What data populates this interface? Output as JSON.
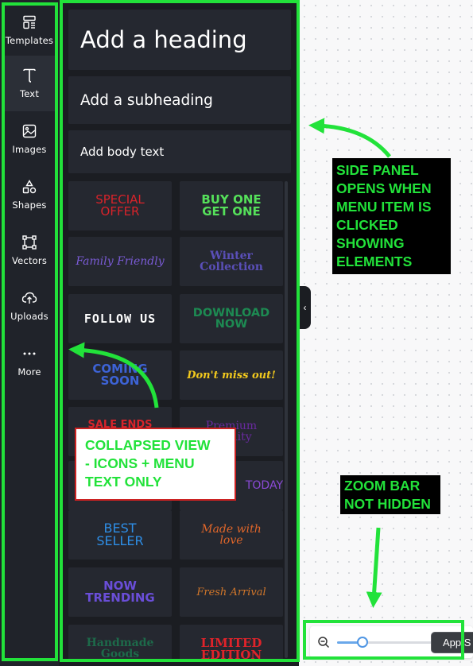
{
  "rail": {
    "items": [
      {
        "label": "Templates",
        "icon": "templates-icon"
      },
      {
        "label": "Text",
        "icon": "text-icon"
      },
      {
        "label": "Images",
        "icon": "image-icon"
      },
      {
        "label": "Shapes",
        "icon": "shapes-icon"
      },
      {
        "label": "Vectors",
        "icon": "vectors-icon"
      },
      {
        "label": "Uploads",
        "icon": "upload-icon"
      },
      {
        "label": "More",
        "icon": "more-icon"
      }
    ],
    "active": "Text"
  },
  "panel": {
    "heading": "Add a heading",
    "subheading": "Add a subheading",
    "body": "Add body text",
    "tiles": [
      {
        "l1": "SPECIAL",
        "l2": "OFFER",
        "color": "#d8232a"
      },
      {
        "l1": "BUY ONE",
        "l2": "GET ONE",
        "color": "#55e05a"
      },
      {
        "l1": "Family Friendly",
        "l2": "",
        "color": "#7a5bd6"
      },
      {
        "l1": "Winter",
        "l2": "Collection",
        "color": "#5a4fb8"
      },
      {
        "l1": "FOLLOW US",
        "l2": "",
        "color": "#ffffff"
      },
      {
        "l1": "DOWNLOAD",
        "l2": "NOW",
        "color": "#1d8a52"
      },
      {
        "l1": "COMING",
        "l2": "SOON",
        "color": "#3d63d6"
      },
      {
        "l1": "Don't miss out!",
        "l2": "",
        "color": "#f2c91d"
      },
      {
        "l1": "SALE ENDS",
        "l2": "",
        "color": "#d8232a"
      },
      {
        "l1": "Premium",
        "l2": "Quality",
        "color": "#6a2aa0"
      },
      {
        "l1": "",
        "l2": "",
        "color": "#d8232a"
      },
      {
        "l1": "TODAY",
        "l2": "",
        "color": "#8a4ad6"
      },
      {
        "l1": "BEST",
        "l2": "SELLER",
        "color": "#2e8ee6"
      },
      {
        "l1": "Made with",
        "l2": "love",
        "color": "#e0662a"
      },
      {
        "l1": "NOW",
        "l2": "TRENDING",
        "color": "#6a4ed8"
      },
      {
        "l1": "Fresh Arrival",
        "l2": "",
        "color": "#d0762a"
      },
      {
        "l1": "Handmade",
        "l2": "Goods",
        "color": "#1d6a4a"
      },
      {
        "l1": "LIMITED",
        "l2": "EDITION",
        "color": "#e0232a"
      }
    ]
  },
  "annotations": {
    "side_panel": [
      "SIDE PANEL",
      "OPENS WHEN",
      "MENU ITEM IS",
      "CLICKED",
      "SHOWING",
      "ELEMENTS"
    ],
    "collapsed": [
      "COLLAPSED VIEW",
      "- ICONS + MENU",
      "TEXT ONLY"
    ],
    "zoom": [
      "ZOOM BAR",
      "NOT HIDDEN"
    ]
  },
  "zoombar": {
    "level": 0.27,
    "app_button": "App S"
  },
  "colors": {
    "highlight": "#22e23a",
    "rail_bg": "#20232a",
    "panel_bg": "#1b1d22",
    "tile_bg": "#252830"
  }
}
